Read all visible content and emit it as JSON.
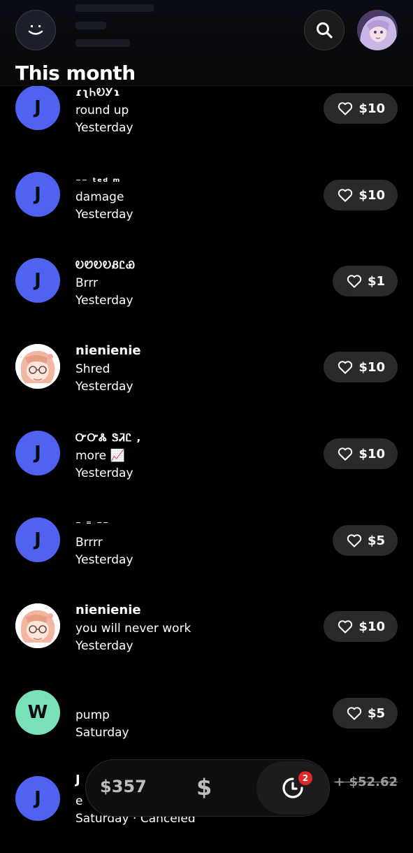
{
  "header": {
    "title": "This month"
  },
  "transactions": [
    {
      "avatar_letter": "J",
      "name": "ɾʅᏂᎧᎩɿ",
      "note": "round up",
      "time": "Yesterday",
      "amount": "$10"
    },
    {
      "avatar_letter": "J",
      "name": "⁻⁻ ᵗᵉᵈ ᵐ",
      "note": "damage",
      "time": "Yesterday",
      "amount": "$10"
    },
    {
      "avatar_letter": "J",
      "name": "ᎧᏬᎧᎧᏰᏝᏯ",
      "note": "Brrr",
      "time": "Yesterday",
      "amount": "$1"
    },
    {
      "avatar_letter": "",
      "name": "nienienie",
      "note": "Shred",
      "time": "Yesterday",
      "amount": "$10"
    },
    {
      "avatar_letter": "J",
      "name": "ᏅᏅᏜ ᏕᏘᏝ ,",
      "note": "more 📈",
      "time": "Yesterday",
      "amount": "$10"
    },
    {
      "avatar_letter": "J",
      "name": "⁻ ⁼ ⁻⁻",
      "note": "Brrrr",
      "time": "Yesterday",
      "amount": "$5"
    },
    {
      "avatar_letter": "",
      "name": "nienienie",
      "note": "you will never work",
      "time": "Yesterday",
      "amount": "$10"
    },
    {
      "avatar_letter": "W",
      "name": "",
      "note": "pump",
      "time": "Saturday",
      "amount": "$5"
    },
    {
      "avatar_letter": "J",
      "name": "J",
      "note": "e",
      "time": "Saturday · Canceled",
      "amount": "+ $52.62"
    }
  ],
  "bottom_bar": {
    "balance": "$357",
    "dollar_symbol": "$",
    "activity_badge": "2"
  },
  "colors": {
    "avatar_blue": "#4f63f0",
    "avatar_green": "#79e0b8",
    "badge_red": "#e0272a",
    "pill_gray": "#2a2a2a"
  },
  "icons": [
    "smiley-menu-icon",
    "search-icon",
    "heart-icon",
    "dollar-icon",
    "activity-clock-icon"
  ]
}
